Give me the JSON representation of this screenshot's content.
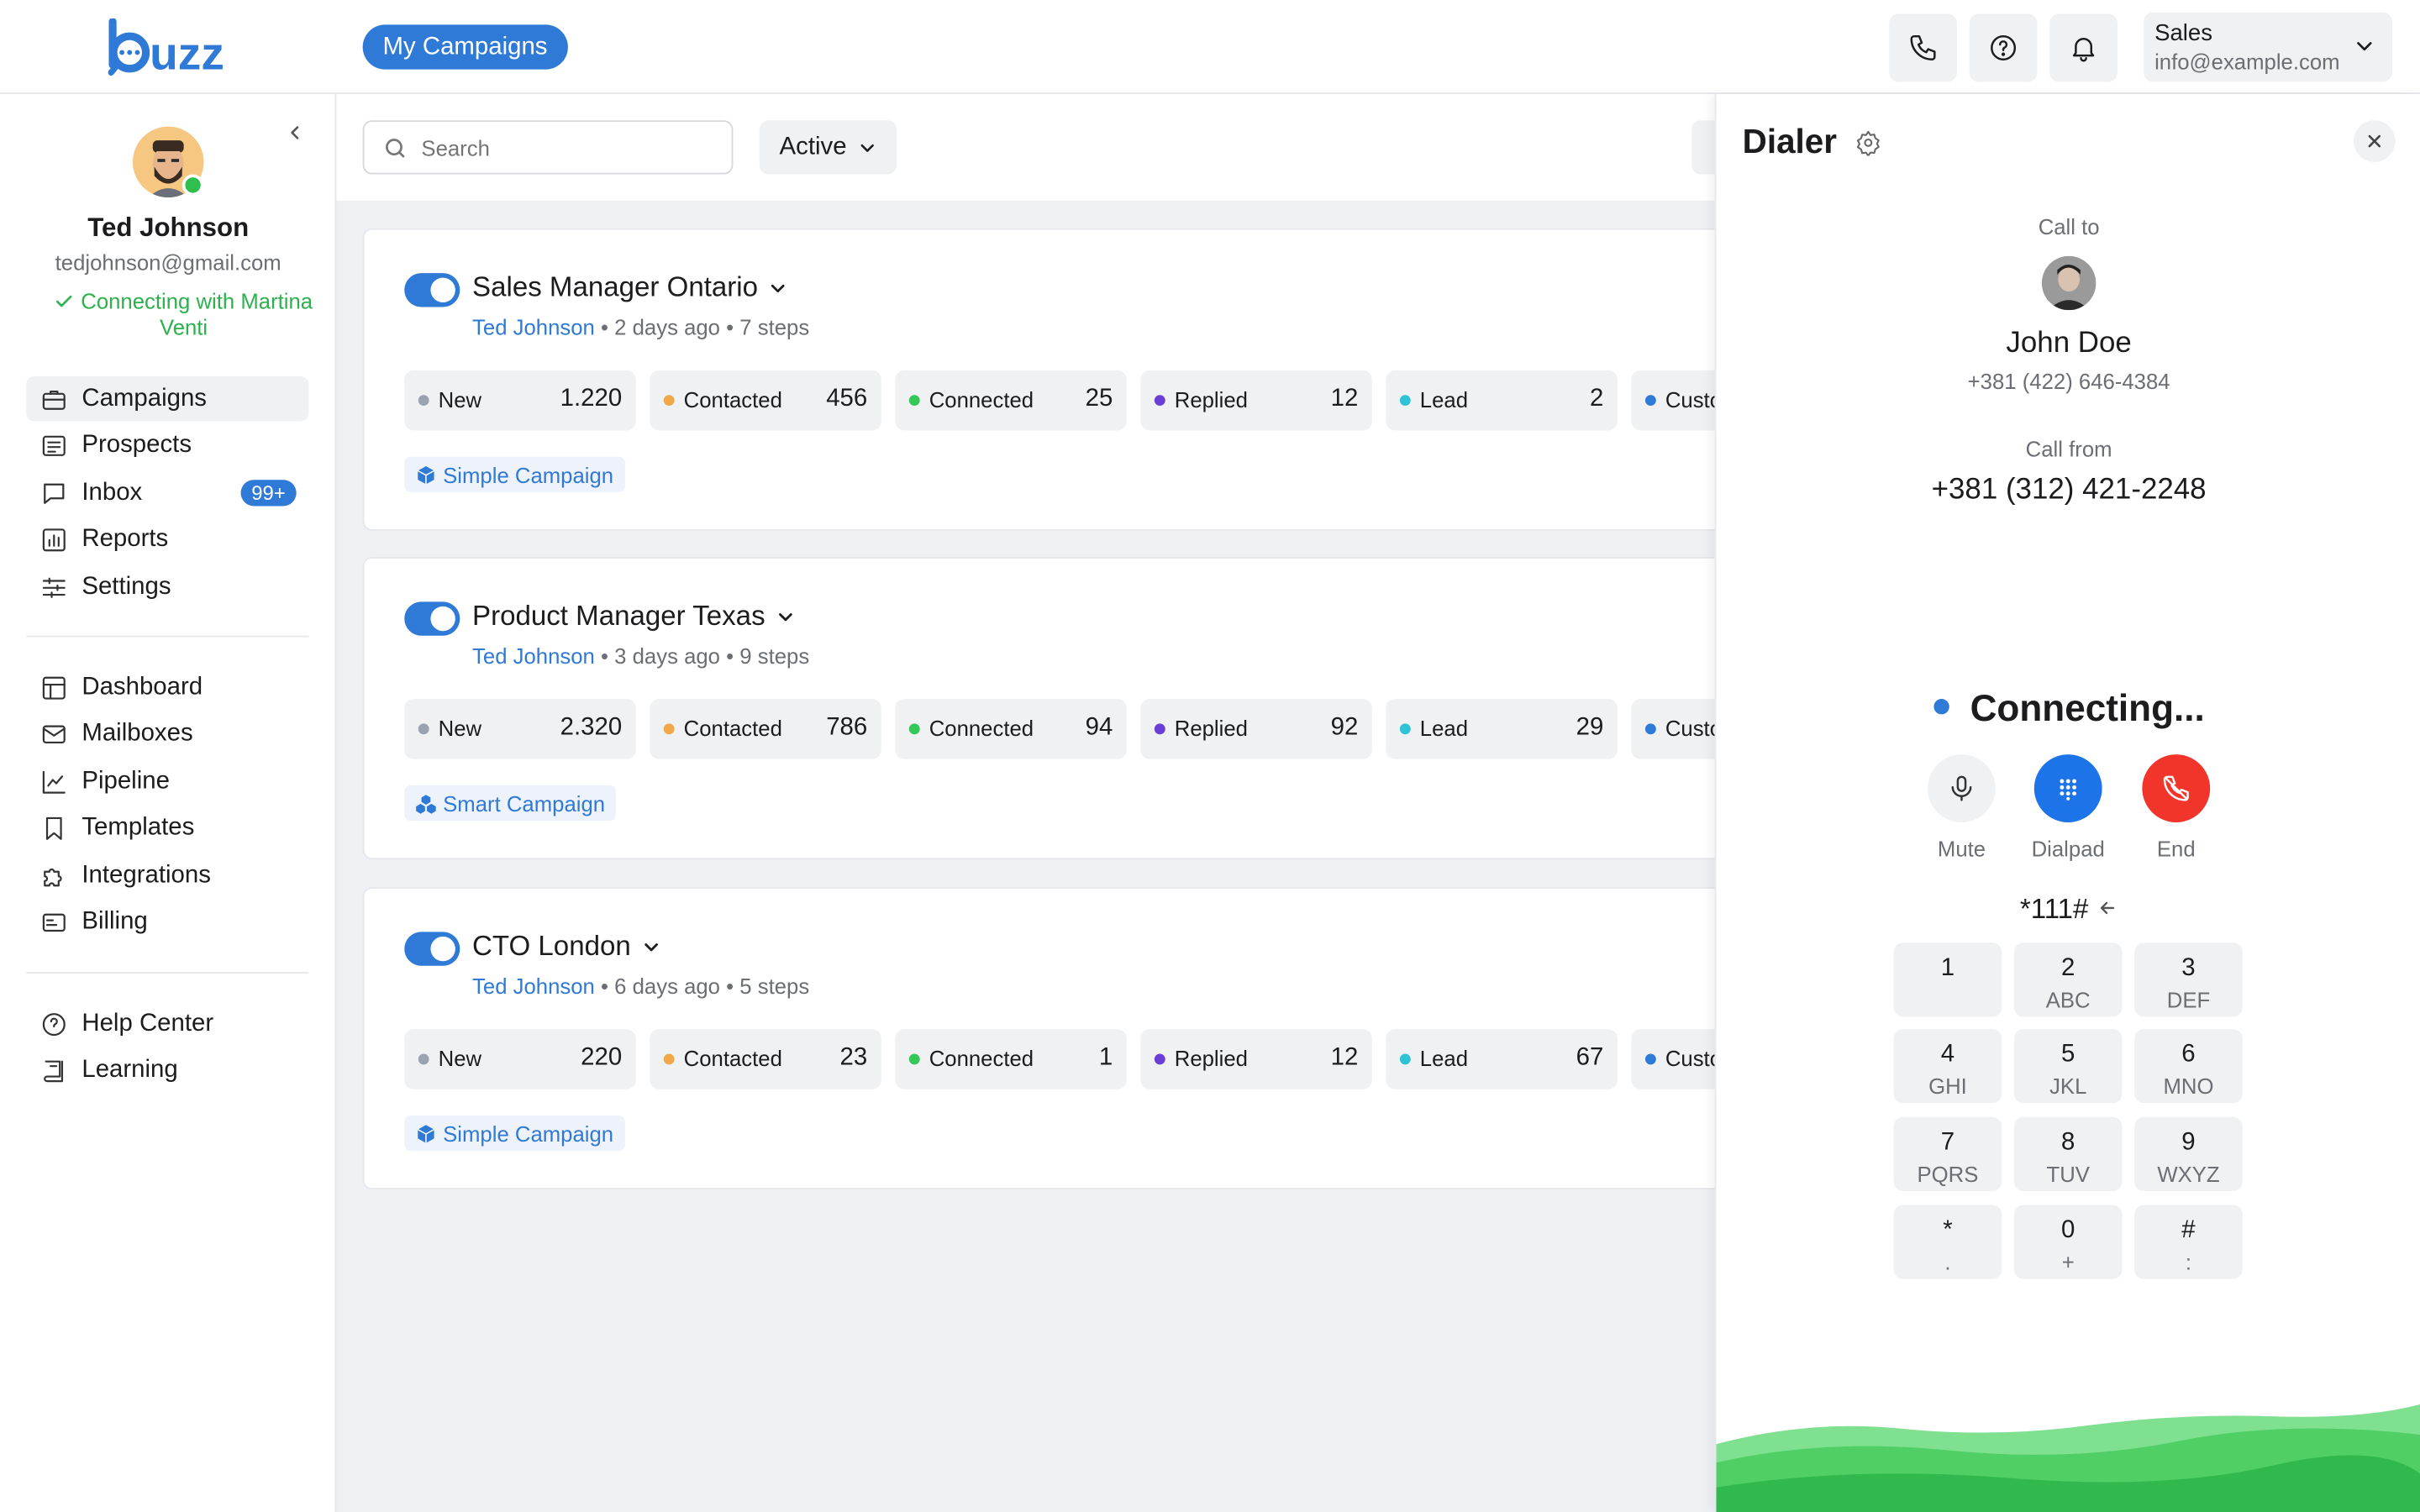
{
  "brand": {
    "logo_text": "buzz",
    "color": "#2f7ad6"
  },
  "header": {
    "nav_button": "My Campaigns",
    "icons": [
      "phone-icon",
      "help-icon",
      "bell-icon"
    ],
    "account": {
      "name": "Sales",
      "email": "info@example.com"
    }
  },
  "sidebar": {
    "user": {
      "name": "Ted Johnson",
      "email": "tedjohnson@gmail.com",
      "status": "Connecting with Martina Venti"
    },
    "primary": [
      {
        "label": "Campaigns",
        "icon": "briefcase-icon",
        "active": true
      },
      {
        "label": "Prospects",
        "icon": "list-icon"
      },
      {
        "label": "Inbox",
        "icon": "chat-icon",
        "badge": "99+"
      },
      {
        "label": "Reports",
        "icon": "bar-chart-icon"
      },
      {
        "label": "Settings",
        "icon": "sliders-icon"
      }
    ],
    "secondary": [
      {
        "label": "Dashboard",
        "icon": "layout-icon"
      },
      {
        "label": "Mailboxes",
        "icon": "mail-icon"
      },
      {
        "label": "Pipeline",
        "icon": "trend-icon"
      },
      {
        "label": "Templates",
        "icon": "bookmark-icon"
      },
      {
        "label": "Integrations",
        "icon": "puzzle-icon"
      },
      {
        "label": "Billing",
        "icon": "card-icon"
      }
    ],
    "tertiary": [
      {
        "label": "Help Center",
        "icon": "help-icon"
      },
      {
        "label": "Learning",
        "icon": "book-icon"
      }
    ]
  },
  "toolbar": {
    "search_placeholder": "Search",
    "filter": "Active"
  },
  "campaigns": [
    {
      "title": "Sales Manager Ontario",
      "owner": "Ted Johnson",
      "meta": " • 2 days ago • 7 steps",
      "stats": [
        {
          "label": "New",
          "value": "1.220"
        },
        {
          "label": "Contacted",
          "value": "456"
        },
        {
          "label": "Connected",
          "value": "25"
        },
        {
          "label": "Replied",
          "value": "12"
        },
        {
          "label": "Lead",
          "value": "2"
        },
        {
          "label": "Custo",
          "value": ""
        }
      ],
      "type": "Simple Campaign"
    },
    {
      "title": "Product Manager Texas",
      "owner": "Ted Johnson",
      "meta": " • 3 days ago • 9 steps",
      "stats": [
        {
          "label": "New",
          "value": "2.320"
        },
        {
          "label": "Contacted",
          "value": "786"
        },
        {
          "label": "Connected",
          "value": "94"
        },
        {
          "label": "Replied",
          "value": "92"
        },
        {
          "label": "Lead",
          "value": "29"
        },
        {
          "label": "Custo",
          "value": ""
        }
      ],
      "type": "Smart Campaign"
    },
    {
      "title": "CTO London",
      "owner": "Ted Johnson",
      "meta": " • 6 days ago • 5 steps",
      "stats": [
        {
          "label": "New",
          "value": "220"
        },
        {
          "label": "Contacted",
          "value": "23"
        },
        {
          "label": "Connected",
          "value": "1"
        },
        {
          "label": "Replied",
          "value": "12"
        },
        {
          "label": "Lead",
          "value": "67"
        },
        {
          "label": "Custo",
          "value": ""
        }
      ],
      "type": "Simple Campaign"
    }
  ],
  "stat_colors": [
    "#9aa3b0",
    "#f0a94a",
    "#34c759",
    "#6a3fd6",
    "#2ec4d6",
    "#2f7ad6"
  ],
  "dialer": {
    "title": "Dialer",
    "call_to_label": "Call to",
    "contact_name": "John Doe",
    "contact_number": "+381 (422) 646-4384",
    "call_from_label": "Call from",
    "from_number": "+381 (312) 421-2248",
    "status": "Connecting...",
    "controls": [
      {
        "label": "Mute",
        "icon": "microphone-icon",
        "color": "#f0f1f3"
      },
      {
        "label": "Dialpad",
        "icon": "dialpad-icon",
        "color": "#1d74e8"
      },
      {
        "label": "End",
        "icon": "hangup-icon",
        "color": "#f2352a"
      }
    ],
    "entry": "*111#",
    "keys": [
      {
        "d": "1",
        "l": ""
      },
      {
        "d": "2",
        "l": "ABC"
      },
      {
        "d": "3",
        "l": "DEF"
      },
      {
        "d": "4",
        "l": "GHI"
      },
      {
        "d": "5",
        "l": "JKL"
      },
      {
        "d": "6",
        "l": "MNO"
      },
      {
        "d": "7",
        "l": "PQRS"
      },
      {
        "d": "8",
        "l": "TUV"
      },
      {
        "d": "9",
        "l": "WXYZ"
      },
      {
        "d": "*",
        "l": "."
      },
      {
        "d": "0",
        "l": "+"
      },
      {
        "d": "#",
        "l": ":"
      }
    ]
  }
}
